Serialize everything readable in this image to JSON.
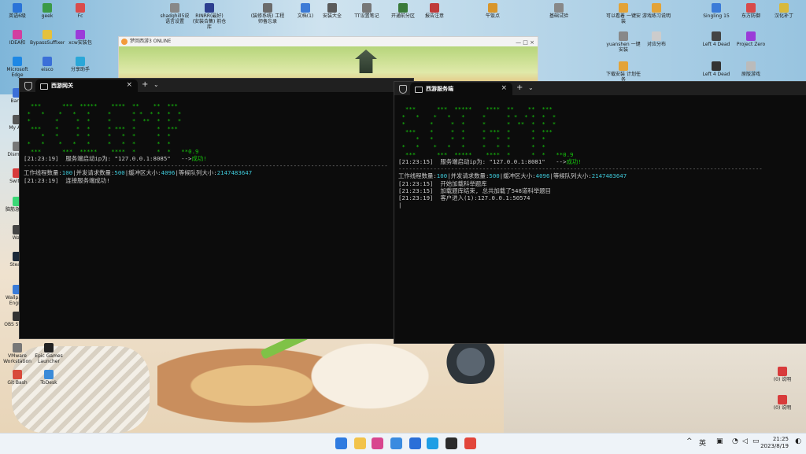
{
  "desktop": {
    "left_icons": [
      {
        "label": "英语6级",
        "color": "#2a73d8"
      },
      {
        "label": "geek",
        "color": "#3b9a47"
      },
      {
        "label": "Fc",
        "color": "#d94c4c"
      },
      {
        "label": "IDEA和",
        "color": "#d23fa0"
      },
      {
        "label": "BypassSuffixer",
        "color": "#e5c13c"
      },
      {
        "label": "xcw安装包",
        "color": "#9b3bd9"
      },
      {
        "label": "Microsoft Edge",
        "color": "#1e88e5"
      },
      {
        "label": "eisco",
        "color": "#3a6fd8"
      },
      {
        "label": "分享助手",
        "color": "#2aa7d8"
      }
    ],
    "top_icons": [
      {
        "label": "shadghill5说 语言设置",
        "color": "#888888"
      },
      {
        "label": "RINRR(最好) (安装合集) 前仓库",
        "color": "#2c3e8f"
      },
      {
        "label": "(装修系统) 工程师备忘录",
        "color": "#6b6b6b"
      },
      {
        "label": "文档(1)",
        "color": "#3d7bd6"
      },
      {
        "label": "安装大全",
        "color": "#5a5a5a"
      },
      {
        "label": "TT设置笔记",
        "color": "#777777"
      },
      {
        "label": "开通前分区",
        "color": "#3a7a3a"
      },
      {
        "label": "报告注意",
        "color": "#bf3b3b"
      },
      {
        "label": "午饭点",
        "color": "#d8962c"
      },
      {
        "label": "基础试验",
        "color": "#888888"
      }
    ],
    "right_icons": [
      {
        "label": "可以看着 一键安装",
        "color": "#e3a338"
      },
      {
        "label": "游戏练习说明",
        "color": "#e3a338"
      },
      {
        "label": "Singling 15",
        "color": "#3b7bd8"
      },
      {
        "label": "东方防御",
        "color": "#d84a4a"
      },
      {
        "label": "汉化补丁",
        "color": "#d8b93b"
      },
      {
        "label": "yuanshen 一键安装",
        "color": "#888888"
      },
      {
        "label": "对应分布",
        "color": "#cccccc"
      },
      {
        "label": "Left 4 Dead",
        "color": "#444444"
      },
      {
        "label": "Project Zero",
        "color": "#9a3bd8"
      },
      {
        "label": "Left 4 Dead",
        "color": "#333333"
      },
      {
        "label": "原版游戏",
        "color": "#bbbbbb"
      },
      {
        "label": "下载安装 计划任务",
        "color": "#e3a338"
      }
    ],
    "left_lower_icons": [
      {
        "label": "Bandi",
        "color": "#3b6fd8"
      },
      {
        "label": "My Acc",
        "color": "#555555"
      },
      {
        "label": "Dism++",
        "color": "#777777"
      },
      {
        "label": "Switch",
        "color": "#d83b3b"
      },
      {
        "label": "脑筋急转弯",
        "color": "#3bd876"
      },
      {
        "label": "Wall",
        "color": "#444444"
      },
      {
        "label": "Steam",
        "color": "#1b2838"
      },
      {
        "label": "Wallpaper Engine",
        "color": "#3a7bd8"
      },
      {
        "label": "OBS Studio",
        "color": "#333333"
      },
      {
        "label": "Epic Games Launcher",
        "color": "#222222"
      },
      {
        "label": "VMware Workstation",
        "color": "#777777"
      },
      {
        "label": "Git Bash",
        "color": "#d84a3b"
      },
      {
        "label": "ToDesk",
        "color": "#3b8bd8"
      }
    ],
    "far_right_icons": [
      {
        "label": "(0) 说明",
        "color": "#d83b3b"
      },
      {
        "label": "(0) 说明",
        "color": "#d83b3b"
      }
    ]
  },
  "game_window": {
    "title": "梦回西游3 ONLINE",
    "controls": "—  □  ×"
  },
  "terminals": [
    {
      "tab_label": "西游网关",
      "ascii_art": [
        "  ***      ***  *****    ****  **    **  ***",
        " *   *    *   *   *     *      * *  * *  *  *",
        " *       *     *  *     *      *  **  *  *  *",
        "  ***    *     *  *     * ***  *      *  ***",
        "     *   *     *  *     *   *  *      *  *",
        " *   *    *   *   *     *   *  *      *  *",
        "  ***      ***  *****    ****  *      *  *   **0.9"
      ],
      "startup_prefix": "[21:23:19]  服务端启动ip为: ",
      "startup_addr": "\"127.0.0.1:8085\"",
      "startup_arrow": "   -->",
      "startup_ok": "成功!",
      "separator": "--------------------------------------------------------------------------------------------------------",
      "config_label_threads": "工作线程数量:",
      "config_threads": "100",
      "config_label_concurrent": "|并发请求数量:",
      "config_concurrent": "500",
      "config_label_buffer": "|缓冲区大小:",
      "config_buffer": "4096",
      "config_label_queue": "|等候队列大小:",
      "config_queue": "2147483647",
      "logs": [
        "[21:23:19]  连接服务端成功!"
      ]
    },
    {
      "tab_label": "西游服务端",
      "ascii_art": [
        "  ***      ***  *****    ****  **    **  ***",
        " *   *    *   *   *     *      * *  * *  *  *",
        " *       *     *  *     *      *  **  *  *  *",
        "  ***    *     *  *     * ***  *      *  ***",
        "     *   *     *  *     *   *  *      *  *",
        " *   *    *   *   *     *   *  *      *  *",
        "  ***      ***  *****    ****  *      *  *   **0.9"
      ],
      "startup_prefix": "[21:23:15]  服务端启动ip为: ",
      "startup_addr": "\"127.0.0.1:8081\"",
      "startup_arrow": "   -->",
      "startup_ok": "成功!",
      "separator": "--------------------------------------------------------------------------------------------------------",
      "config_label_threads": "工作线程数量:",
      "config_threads": "100",
      "config_label_concurrent": "|并发请求数量:",
      "config_concurrent": "500",
      "config_label_buffer": "|缓冲区大小:",
      "config_buffer": "4096",
      "config_label_queue": "|等候队列大小:",
      "config_queue": "2147483647",
      "logs": [
        "[21:23:15]  开始加载科举题库",
        "[21:23:15]  加载题库结束, 总共加载了548道科举题目",
        "[21:23:19]  客户进入(1):127.0.0.1:50574"
      ]
    }
  ],
  "taskbar": {
    "apps": [
      {
        "name": "start",
        "color": "#2f7be0"
      },
      {
        "name": "file-explorer",
        "color": "#f2c34a"
      },
      {
        "name": "app-pink",
        "color": "#d8468f"
      },
      {
        "name": "app-store",
        "color": "#3a8be0"
      },
      {
        "name": "app-k",
        "color": "#2a6fd8"
      },
      {
        "name": "edge",
        "color": "#1f9ee5"
      },
      {
        "name": "terminal",
        "color": "#2b2b2b"
      },
      {
        "name": "chrome",
        "color": "#e2463b"
      }
    ],
    "tray_chevron": "^",
    "ime": "英",
    "clock_time": "21:25",
    "clock_date": "2023/8/19"
  }
}
